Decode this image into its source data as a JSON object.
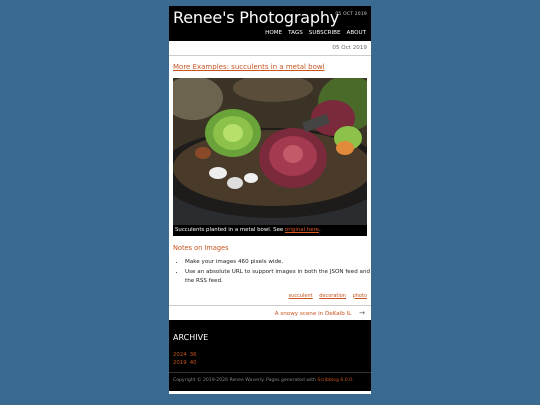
{
  "header": {
    "site_title": "Renee's Photography",
    "date": "05 OCT 2019",
    "nav": [
      "HOME",
      "TAGS",
      "SUBSCRIBE",
      "ABOUT"
    ]
  },
  "post": {
    "date": "05 Oct 2019",
    "title": "More Examples: succulents in a metal bowl",
    "caption_text": "Succulents planted in a metal bowl. See ",
    "caption_link": "original here",
    "caption_end": "."
  },
  "notes": {
    "heading": "Notes on Images",
    "items": [
      "Make your images 460 pixels wide.",
      "Use an absolute URL to support images in both the JSON feed and the RSS feed."
    ]
  },
  "tags": [
    "succulent",
    "decoration",
    "photo"
  ],
  "next_post": {
    "label": "A snowy scene in DeKalb IL",
    "arrow": "→"
  },
  "archive": {
    "heading": "ARCHIVE",
    "years": [
      {
        "year": "2024",
        "count": "36"
      },
      {
        "year": "2019",
        "count": "40"
      }
    ]
  },
  "footer": {
    "text": "Copyright © 2019-2026 Renee Waverly. Pages generated with ",
    "link": "Scribblog 6.0.0",
    "end": "."
  },
  "colors": {
    "background": "#3a6a8f",
    "accent": "#c8541e",
    "header_bg": "#000000"
  }
}
